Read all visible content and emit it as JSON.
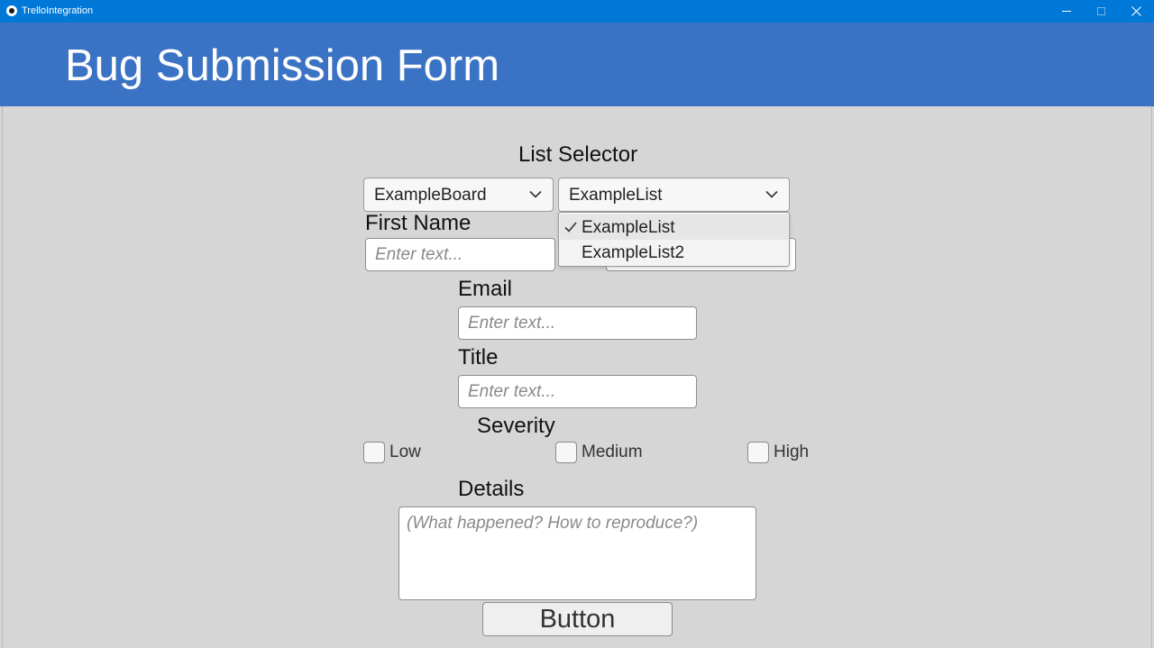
{
  "window": {
    "title": "TrelloIntegration"
  },
  "header": {
    "title": "Bug Submission Form"
  },
  "list_selector": {
    "label": "List Selector",
    "board_value": "ExampleBoard",
    "list_value": "ExampleList",
    "options": [
      "ExampleList",
      "ExampleList2"
    ]
  },
  "form": {
    "first_name_label": "First Name",
    "email_label": "Email",
    "title_label": "Title",
    "severity_label": "Severity",
    "details_label": "Details",
    "placeholder": "Enter text...",
    "details_placeholder": "(What happened? How to reproduce?)",
    "severity_options": [
      "Low",
      "Medium",
      "High"
    ],
    "submit_label": "Button"
  },
  "colors": {
    "titlebar": "#0078d7",
    "header": "#3b73c4",
    "background": "#d6d6d6"
  }
}
